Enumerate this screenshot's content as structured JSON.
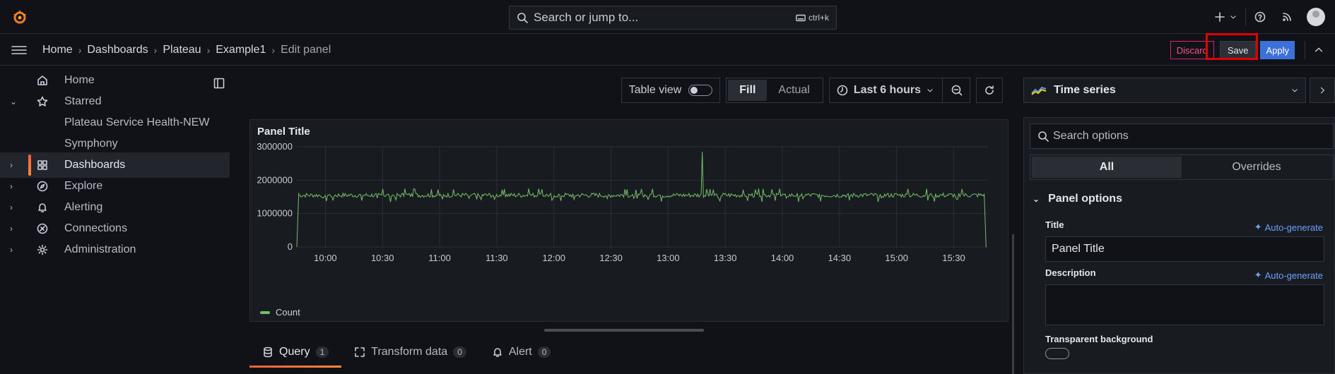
{
  "topbar": {
    "search_placeholder": "Search or jump to...",
    "shortcut": "ctrl+k",
    "icons": [
      "grafana-logo-icon",
      "search-icon",
      "keyboard-icon",
      "plus-icon",
      "help-icon",
      "news-icon",
      "avatar"
    ]
  },
  "breadcrumbs": [
    "Home",
    "Dashboards",
    "Plateau",
    "Example1",
    "Edit panel"
  ],
  "actions": {
    "discard": "Discard",
    "save": "Save",
    "apply": "Apply"
  },
  "sidebar": {
    "items": [
      {
        "label": "Home",
        "icon": "home-icon"
      },
      {
        "label": "Starred",
        "icon": "star-icon",
        "expanded": true
      },
      {
        "label": "Plateau Service Health-NEW"
      },
      {
        "label": "Symphony"
      },
      {
        "label": "Dashboards",
        "icon": "dashboards-icon",
        "active": true
      },
      {
        "label": "Explore",
        "icon": "compass-icon"
      },
      {
        "label": "Alerting",
        "icon": "bell-icon"
      },
      {
        "label": "Connections",
        "icon": "connections-icon"
      },
      {
        "label": "Administration",
        "icon": "gear-icon"
      }
    ]
  },
  "toolbar": {
    "table_view": "Table view",
    "fill": "Fill",
    "actual": "Actual",
    "time_range": "Last 6 hours"
  },
  "panel": {
    "title": "Panel Title",
    "legend": "Count"
  },
  "chart_data": {
    "type": "line",
    "title": "Panel Title",
    "xlabel": "",
    "ylabel": "",
    "x_ticks": [
      "10:00",
      "10:30",
      "11:00",
      "11:30",
      "12:00",
      "12:30",
      "13:00",
      "13:30",
      "14:00",
      "14:30",
      "15:00",
      "15:30"
    ],
    "y_ticks": [
      "0",
      "1000000",
      "2000000",
      "3000000"
    ],
    "ylim": [
      0,
      3000000
    ],
    "xlim": [
      "09:45",
      "15:48"
    ],
    "series": [
      {
        "name": "Count",
        "color": "#73bf69",
        "baseline": 1550000,
        "noise_range": [
          1350000,
          1750000
        ],
        "points": [
          [
            "09:45",
            0
          ],
          [
            "09:46",
            1600000
          ],
          [
            "10:00",
            1600000
          ],
          [
            "11:00",
            1560000
          ],
          [
            "12:00",
            1580000
          ],
          [
            "13:00",
            1560000
          ],
          [
            "13:17",
            1560000
          ],
          [
            "13:18",
            2850000
          ],
          [
            "13:19",
            1560000
          ],
          [
            "14:00",
            1580000
          ],
          [
            "15:00",
            1570000
          ],
          [
            "15:46",
            1600000
          ],
          [
            "15:47",
            0
          ]
        ]
      }
    ],
    "grid": true,
    "legend": "bottom-left"
  },
  "query_tabs": [
    {
      "label": "Query",
      "count": "1",
      "icon": "database-icon"
    },
    {
      "label": "Transform data",
      "count": "0",
      "icon": "transform-icon"
    },
    {
      "label": "Alert",
      "count": "0",
      "icon": "bell-icon"
    }
  ],
  "options": {
    "viz": "Time series",
    "search_placeholder": "Search options",
    "tabs": [
      "All",
      "Overrides"
    ],
    "section": "Panel options",
    "title_label": "Title",
    "title_value": "Panel Title",
    "auto_generate": "Auto-generate",
    "description_label": "Description",
    "transparent_label": "Transparent background"
  }
}
